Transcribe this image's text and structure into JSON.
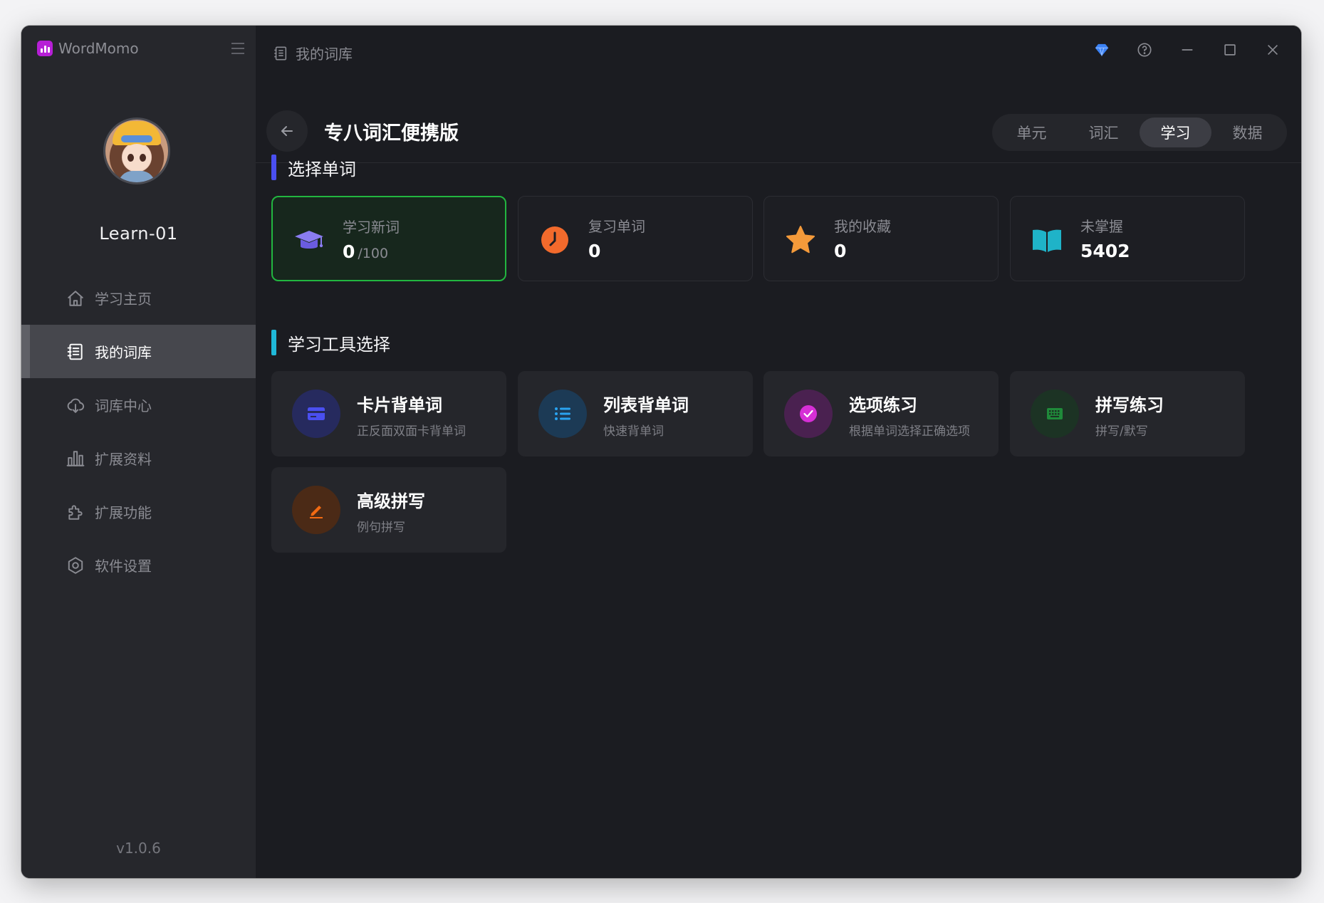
{
  "app": {
    "name": "WordMomo",
    "version": "v1.0.6"
  },
  "user": {
    "name": "Learn-01"
  },
  "nav": [
    {
      "label": "学习主页",
      "icon": "home-icon",
      "active": false
    },
    {
      "label": "我的词库",
      "icon": "book-list-icon",
      "active": true
    },
    {
      "label": "词库中心",
      "icon": "cloud-download-icon",
      "active": false
    },
    {
      "label": "扩展资料",
      "icon": "bar-chart-icon",
      "active": false
    },
    {
      "label": "扩展功能",
      "icon": "puzzle-icon",
      "active": false
    },
    {
      "label": "软件设置",
      "icon": "settings-icon",
      "active": false
    }
  ],
  "titlebar": {
    "breadcrumb": "我的词库"
  },
  "header": {
    "title": "专八词汇便携版",
    "tabs": [
      {
        "label": "单元",
        "active": false
      },
      {
        "label": "词汇",
        "active": false
      },
      {
        "label": "学习",
        "active": true
      },
      {
        "label": "数据",
        "active": false
      }
    ]
  },
  "select_section": {
    "title": "选择单词",
    "accent": "#4a4ff0",
    "cards": [
      {
        "label": "学习新词",
        "value": "0",
        "suffix": "/100",
        "icon": "graduation-cap-icon",
        "color": "#8a7cf0",
        "selected": true
      },
      {
        "label": "复习单词",
        "value": "0",
        "icon": "clock-icon",
        "color": "#f26a2c",
        "selected": false
      },
      {
        "label": "我的收藏",
        "value": "0",
        "icon": "star-icon",
        "color": "#f49a3a",
        "selected": false
      },
      {
        "label": "未掌握",
        "value": "5402",
        "icon": "open-book-icon",
        "color": "#1fb3c8",
        "selected": false
      }
    ]
  },
  "tools_section": {
    "title": "学习工具选择",
    "accent": "#1fb8d8",
    "tools": [
      {
        "name": "卡片背单词",
        "desc": "正反面双面卡背单词",
        "icon": "card-icon",
        "color": "#4a4ff0"
      },
      {
        "name": "列表背单词",
        "desc": "快速背单词",
        "icon": "list-icon",
        "color": "#2aa3f0"
      },
      {
        "name": "选项练习",
        "desc": "根据单词选择正确选项",
        "icon": "check-circle-icon",
        "color": "#d62fd6"
      },
      {
        "name": "拼写练习",
        "desc": "拼写/默写",
        "icon": "keyboard-icon",
        "color": "#1f8a3a"
      },
      {
        "name": "高级拼写",
        "desc": "例句拼写",
        "icon": "pencil-icon",
        "color": "#f26a12"
      }
    ]
  }
}
